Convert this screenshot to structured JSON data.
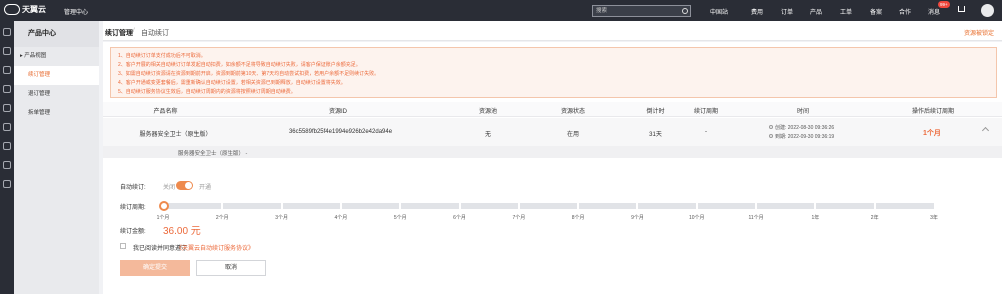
{
  "topbar": {
    "logo_text": "天翼云",
    "title": "管理中心",
    "search_placeholder": "搜索",
    "nav": [
      "中国站",
      "费用",
      "订单",
      "产品",
      "工单",
      "备案",
      "合作",
      "消息"
    ],
    "badge": "99+"
  },
  "sidebar": {
    "title": "产品中心",
    "items": [
      "产品视图",
      "续订管理",
      "退订管理",
      "拆单管理"
    ]
  },
  "breadcrumb": {
    "main": "续订管理",
    "sep": "/",
    "sub": "自动续订",
    "link": "资源被锁定"
  },
  "notice": [
    "1、自动续订订单支付成功后不可取消。",
    "2、客户开展的相关自动续订订单发起自动扣费，如余额不足将导致自动续订失败，请客户保证账户余额充足。",
    "3、如需自动续订资源请在资源到期前开启，资源到期前第10天、第7天均自动尝试扣费，若用户余额不足则续订失败。",
    "4、客户开通或变更套餐后，需重新确认自动续订设置，若相关资源已到期释放，自动续订设置将失效。",
    "5、自动续订服务协议生效后，自动续订周期内的资源将按照续订周期自动续费。"
  ],
  "table": {
    "headers": [
      "产品名称",
      "资源ID",
      "资源池",
      "资源状态",
      "倒计时",
      "续订周期",
      "时间",
      "操作后续订周期"
    ],
    "row": {
      "name": "服务器安全卫士（原生版）",
      "id": "36c5589fb25f4e1994e926b2e42da94e",
      "pool": "无",
      "status": "在用",
      "countdown": "31天",
      "cycle": "-",
      "created": "创建: 2022-08-30 09:36:26",
      "expire": "到期: 2022-09-30 09:36:19",
      "period": "1个月"
    },
    "sub": "服务器安全卫士（原生版）  -"
  },
  "form": {
    "auto_label": "自动续订:",
    "off": "关闭",
    "on": "开通",
    "cycle_label": "续订周期:",
    "ticks": [
      "1个月",
      "2个月",
      "3个月",
      "4个月",
      "5个月",
      "6个月",
      "7个月",
      "8个月",
      "9个月",
      "10个月",
      "11个月",
      "1年",
      "2年",
      "3年"
    ],
    "selected_tick": "1个月",
    "amount_label": "续订金额:",
    "amount": "36.00 元",
    "agree": "我已阅读并同意遵守",
    "agree_link": "《天翼云自动续订服务协议》",
    "confirm": "确定提交",
    "cancel": "取消"
  }
}
